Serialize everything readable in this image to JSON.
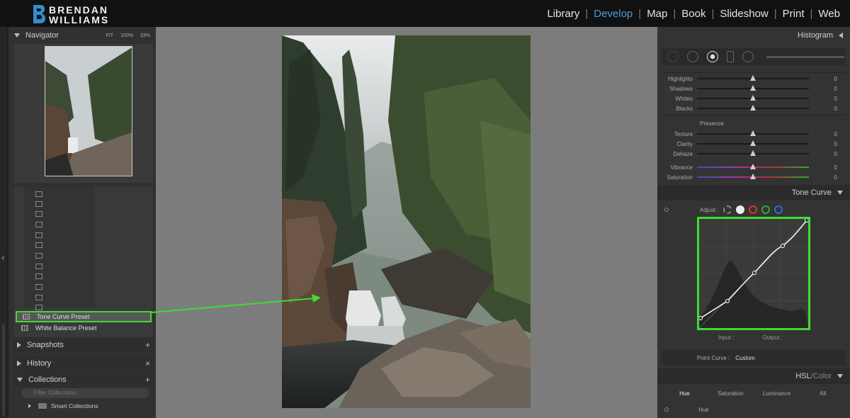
{
  "brand": {
    "line1": "BRENDAN",
    "line2": "WILLIAMS"
  },
  "modules": [
    {
      "label": "Library",
      "active": false
    },
    {
      "label": "Develop",
      "active": true
    },
    {
      "label": "Map",
      "active": false
    },
    {
      "label": "Book",
      "active": false
    },
    {
      "label": "Slideshow",
      "active": false
    },
    {
      "label": "Print",
      "active": false
    },
    {
      "label": "Web",
      "active": false
    }
  ],
  "navigator": {
    "title": "Navigator",
    "opts": [
      "FIT",
      "100%",
      "33%"
    ]
  },
  "presets": {
    "tone_curve": "Tone Curve Preset",
    "white_balance": "White Balance Preset"
  },
  "left_sections": {
    "snapshots": "Snapshots",
    "history": "History",
    "collections": "Collections"
  },
  "collections": {
    "search_placeholder": "Filter Collections",
    "smart": "Smart Collections"
  },
  "histogram": {
    "title": "Histogram"
  },
  "basic_sliders": [
    {
      "label": "Highlights",
      "value": "0"
    },
    {
      "label": "Shadows",
      "value": "0"
    },
    {
      "label": "Whites",
      "value": "0"
    },
    {
      "label": "Blacks",
      "value": "0"
    }
  ],
  "presence": {
    "label": "Presence"
  },
  "presence_sliders": [
    {
      "label": "Texture",
      "value": "0"
    },
    {
      "label": "Clarity",
      "value": "0"
    },
    {
      "label": "Dehaze",
      "value": "0"
    },
    {
      "label": "Vibrance",
      "value": "0"
    },
    {
      "label": "Saturation",
      "value": "0"
    }
  ],
  "tone_curve": {
    "title": "Tone Curve",
    "adjust_label": "Adjust :",
    "input_label": "Input :",
    "output_label": "Output :",
    "point_curve_label": "Point Curve :",
    "point_curve_value": "Custom"
  },
  "hsl": {
    "title_a": "HSL",
    "title_sep": " / ",
    "title_b": "Color",
    "tabs": [
      "Hue",
      "Saturation",
      "Luminance",
      "All"
    ],
    "row": "Hue"
  },
  "colors": {
    "accent": "#4c9bd9",
    "highlight": "#3edc2f"
  }
}
